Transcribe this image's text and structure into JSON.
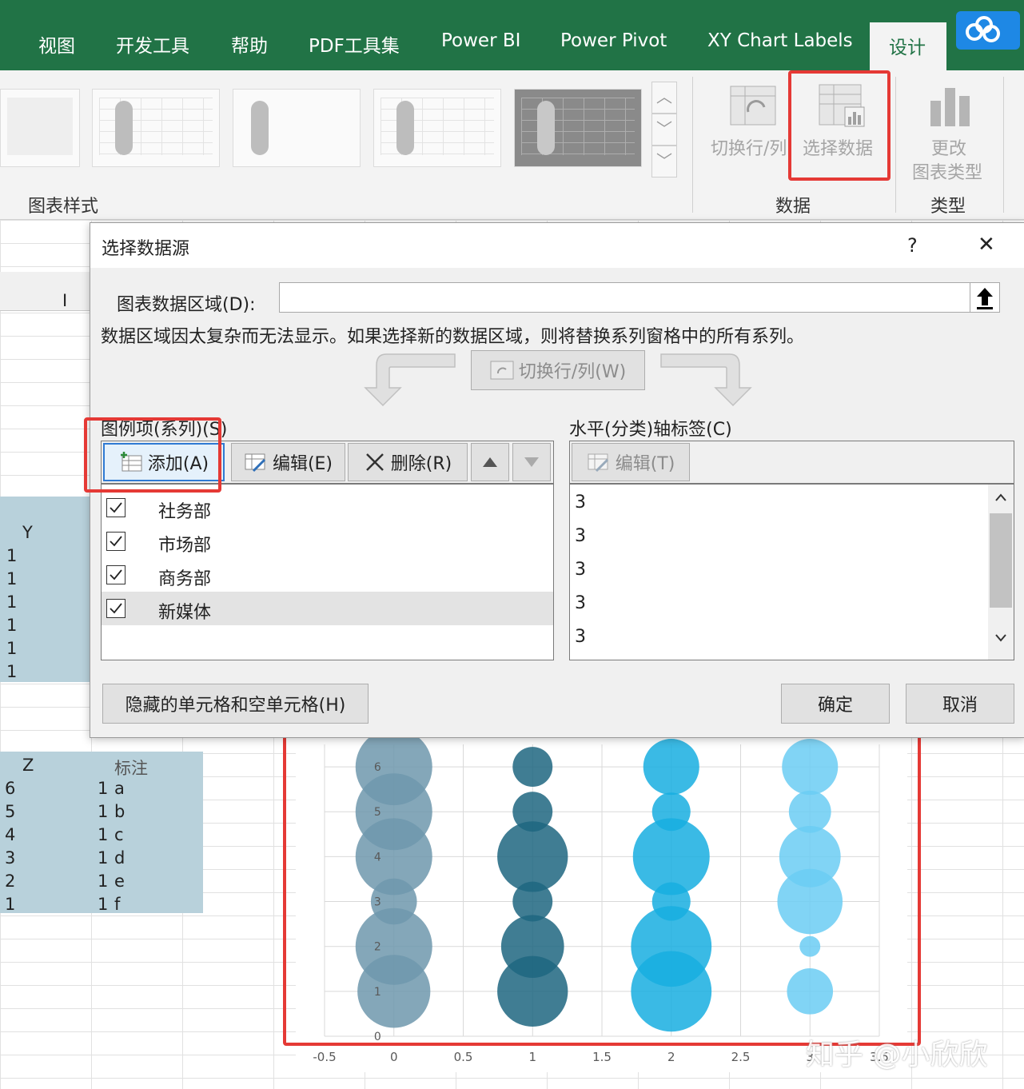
{
  "ribbon": {
    "tabs": [
      "视图",
      "开发工具",
      "帮助",
      "PDF工具集",
      "Power BI",
      "Power Pivot",
      "XY Chart Labels"
    ],
    "active_tab": "设计",
    "chart_styles_group": "图表样式",
    "switch_row_col": "切换行/列",
    "select_data": "选择数据",
    "change_type_line1": "更改",
    "change_type_line2": "图表类型",
    "data_group": "数据",
    "type_group": "类型"
  },
  "sheet": {
    "column_i": "I",
    "y_header": "Y",
    "y_values": [
      "1",
      "1",
      "1",
      "1",
      "1",
      "1"
    ],
    "z_header": "Z",
    "note_header": "标注",
    "z_rows": [
      {
        "z": "6",
        "n": "1",
        "label": "a"
      },
      {
        "z": "5",
        "n": "1",
        "label": "b"
      },
      {
        "z": "4",
        "n": "1",
        "label": "c"
      },
      {
        "z": "3",
        "n": "1",
        "label": "d"
      },
      {
        "z": "2",
        "n": "1",
        "label": "e"
      },
      {
        "z": "1",
        "n": "1",
        "label": "f"
      }
    ]
  },
  "dialog": {
    "title": "选择数据源",
    "help": "?",
    "close": "✕",
    "range_label": "图表数据区域(D):",
    "range_value": "",
    "range_message": "数据区域因太复杂而无法显示。如果选择新的数据区域，则将替换系列窗格中的所有系列。",
    "switch_button": "切换行/列(W)",
    "legend_title": "图例项(系列)(S)",
    "add_button": "添加(A)",
    "edit_button": "编辑(E)",
    "delete_button": "删除(R)",
    "series": [
      {
        "name": "社务部",
        "checked": true
      },
      {
        "name": "市场部",
        "checked": true
      },
      {
        "name": "商务部",
        "checked": true
      },
      {
        "name": "新媒体",
        "checked": true
      }
    ],
    "axis_title": "水平(分类)轴标签(C)",
    "axis_edit_button": "编辑(T)",
    "axis_labels": [
      "3",
      "3",
      "3",
      "3",
      "3"
    ],
    "hidden_cells_button": "隐藏的单元格和空单元格(H)",
    "ok_button": "确定",
    "cancel_button": "取消"
  },
  "watermark": "知乎 @小欣欣",
  "chart_data": {
    "type": "scatter",
    "title": "",
    "xlabel": "",
    "ylabel": "",
    "x_ticks": [
      "-0.5",
      "0",
      "0.5",
      "1",
      "1.5",
      "2",
      "2.5",
      "3",
      "3.5"
    ],
    "y_ticks": [
      "0",
      "1",
      "2",
      "3",
      "4",
      "5",
      "6"
    ],
    "xlim": [
      -0.5,
      3.5
    ],
    "ylim": [
      0,
      6.5
    ],
    "grid": true,
    "series": [
      {
        "color": "#6f98ad",
        "points": [
          {
            "x": 0,
            "y": 6,
            "r": 1.0
          },
          {
            "x": 0,
            "y": 5,
            "r": 1.0
          },
          {
            "x": 0,
            "y": 4,
            "r": 1.0
          },
          {
            "x": 0,
            "y": 3,
            "r": 0.6
          },
          {
            "x": 0,
            "y": 2,
            "r": 1.0
          },
          {
            "x": 0,
            "y": 1,
            "r": 0.95
          }
        ]
      },
      {
        "color": "#1e6680",
        "points": [
          {
            "x": 1,
            "y": 6,
            "r": 0.52
          },
          {
            "x": 1,
            "y": 5,
            "r": 0.52
          },
          {
            "x": 1,
            "y": 4,
            "r": 0.92
          },
          {
            "x": 1,
            "y": 3,
            "r": 0.52
          },
          {
            "x": 1,
            "y": 2,
            "r": 0.82
          },
          {
            "x": 1,
            "y": 1,
            "r": 0.92
          }
        ]
      },
      {
        "color": "#18aee0",
        "points": [
          {
            "x": 2,
            "y": 6,
            "r": 0.73
          },
          {
            "x": 2,
            "y": 5,
            "r": 0.5
          },
          {
            "x": 2,
            "y": 4,
            "r": 1.0
          },
          {
            "x": 2,
            "y": 3,
            "r": 0.5
          },
          {
            "x": 2,
            "y": 2,
            "r": 1.05
          },
          {
            "x": 2,
            "y": 1,
            "r": 1.05
          }
        ]
      },
      {
        "color": "#6bcdf3",
        "points": [
          {
            "x": 3,
            "y": 6,
            "r": 0.73
          },
          {
            "x": 3,
            "y": 5,
            "r": 0.55
          },
          {
            "x": 3,
            "y": 4,
            "r": 0.8
          },
          {
            "x": 3,
            "y": 3,
            "r": 0.85
          },
          {
            "x": 3,
            "y": 2,
            "r": 0.27
          },
          {
            "x": 3,
            "y": 1,
            "r": 0.6
          }
        ]
      }
    ]
  }
}
